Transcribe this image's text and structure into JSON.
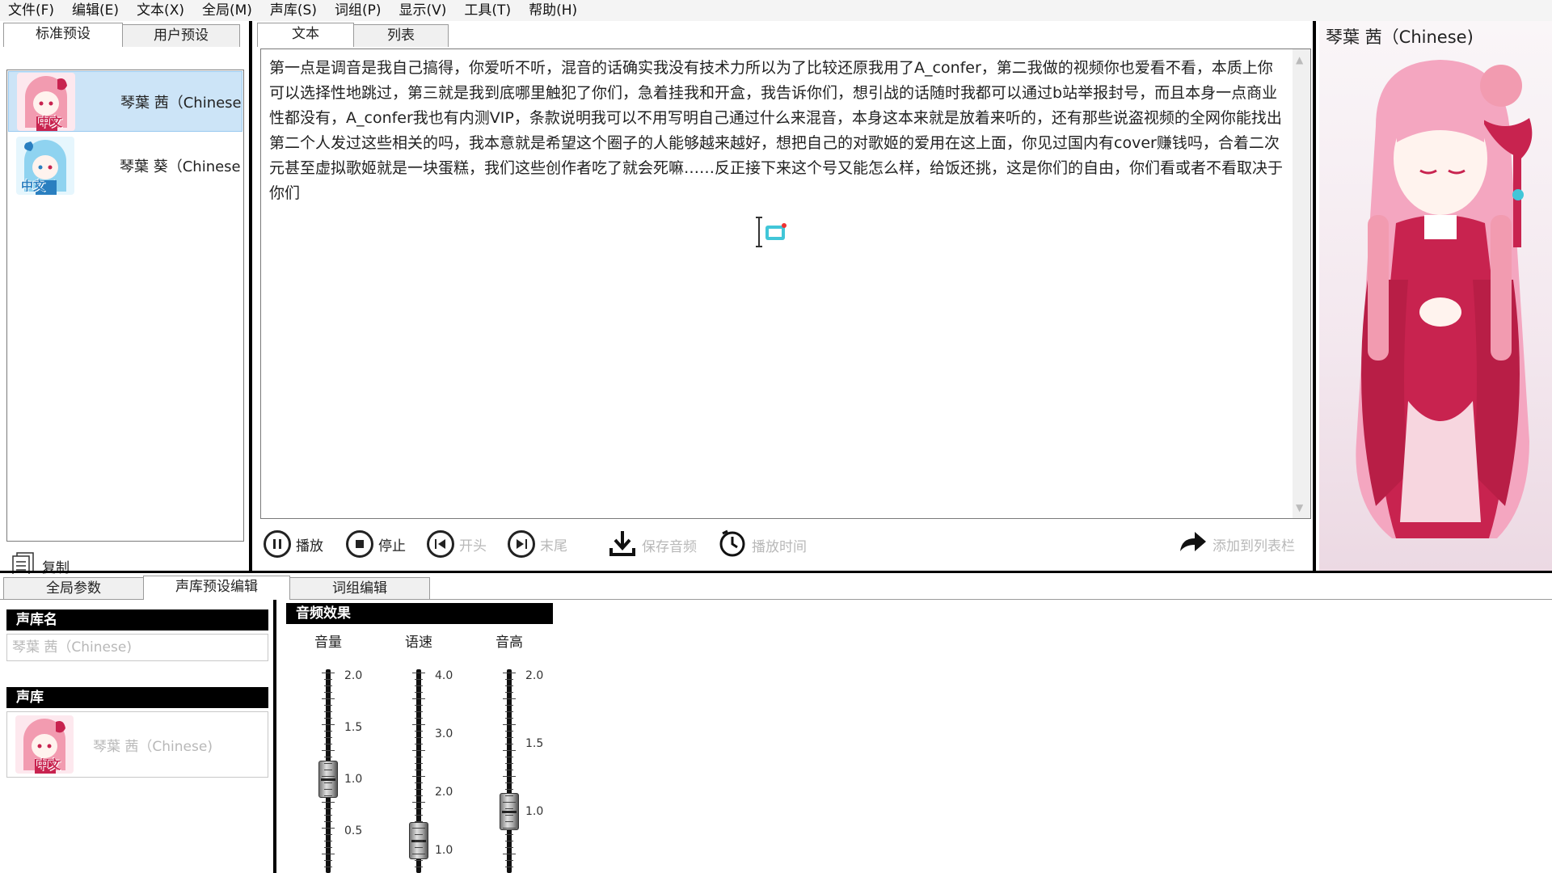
{
  "menubar": {
    "items": [
      "文件(F)",
      "编辑(E)",
      "文本(X)",
      "全局(M)",
      "声库(S)",
      "词组(P)",
      "显示(V)",
      "工具(T)",
      "帮助(H)"
    ]
  },
  "left_panel": {
    "tabs": [
      "标准预设",
      "用户预设"
    ],
    "presets": [
      {
        "name": "琴葉 茜（Chinese",
        "selected": true,
        "badge": "中文"
      },
      {
        "name": "琴葉 葵（Chinese",
        "selected": false,
        "badge": "中文"
      }
    ],
    "copy_label": "复制"
  },
  "editor": {
    "tabs": [
      "文本",
      "列表"
    ],
    "text": "第一点是调音是我自己搞得，你爱听不听，混音的话确实我没有技术力所以为了比较还原我用了A_confer，第二我做的视频你也爱看不看，本质上你可以选择性地跳过，第三就是我到底哪里触犯了你们，急着挂我和开盒，我告诉你们，想引战的话随时我都可以通过b站举报封号，而且本身一点商业性都没有，A_confer我也有内测VIP，条款说明我可以不用写明自己通过什么来混音，本身这本来就是放着来听的，还有那些说盗视频的全网你能找出第二个人发过这些相关的吗，我本意就是希望这个圈子的人能够越来越好，想把自己的对歌姬的爱用在这上面，你见过国内有cover赚钱吗，合着二次元甚至虚拟歌姬就是一块蛋糕，我们这些创作者吃了就会死嘛……反正接下来这个号又能怎么样，给饭还挑，这是你们的自由，你们看或者不看取决于你们"
  },
  "toolbar": {
    "play_label": "播放",
    "stop_label": "停止",
    "start_label": "开头",
    "end_label": "末尾",
    "save_audio_label": "保存音频",
    "play_time_label": "播放时间",
    "add_to_list_label": "添加到列表栏"
  },
  "portrait": {
    "title": "琴葉 茜（Chinese)"
  },
  "bottom": {
    "tabs": [
      "全局参数",
      "声库预设编辑",
      "词组编辑"
    ],
    "voicebank_name_header": "声库名",
    "voicebank_name_value": "琴葉 茜（Chinese)",
    "voicebank_header": "声库",
    "voicebank_value": "琴葉 茜（Chinese)",
    "voicebank_badge": "中文",
    "audio_effects_header": "音频效果",
    "sliders": [
      {
        "label": "音量",
        "ticks": [
          "2.0",
          "1.5",
          "1.0",
          "0.5"
        ],
        "value": 1.0
      },
      {
        "label": "语速",
        "ticks": [
          "4.0",
          "3.0",
          "2.0",
          "1.0"
        ],
        "value": 1.0
      },
      {
        "label": "音高",
        "ticks": [
          "2.0",
          "1.5",
          "1.0"
        ],
        "value": 1.0
      }
    ]
  },
  "colors": {
    "selected_row": "#cce4f7",
    "avatar_pink": "#f29bb0",
    "avatar_blue": "#8fd3f0",
    "portrait_dress": "#c8234f",
    "portrait_hair": "#f4a6c0",
    "icon_teal": "#41c6d8"
  }
}
